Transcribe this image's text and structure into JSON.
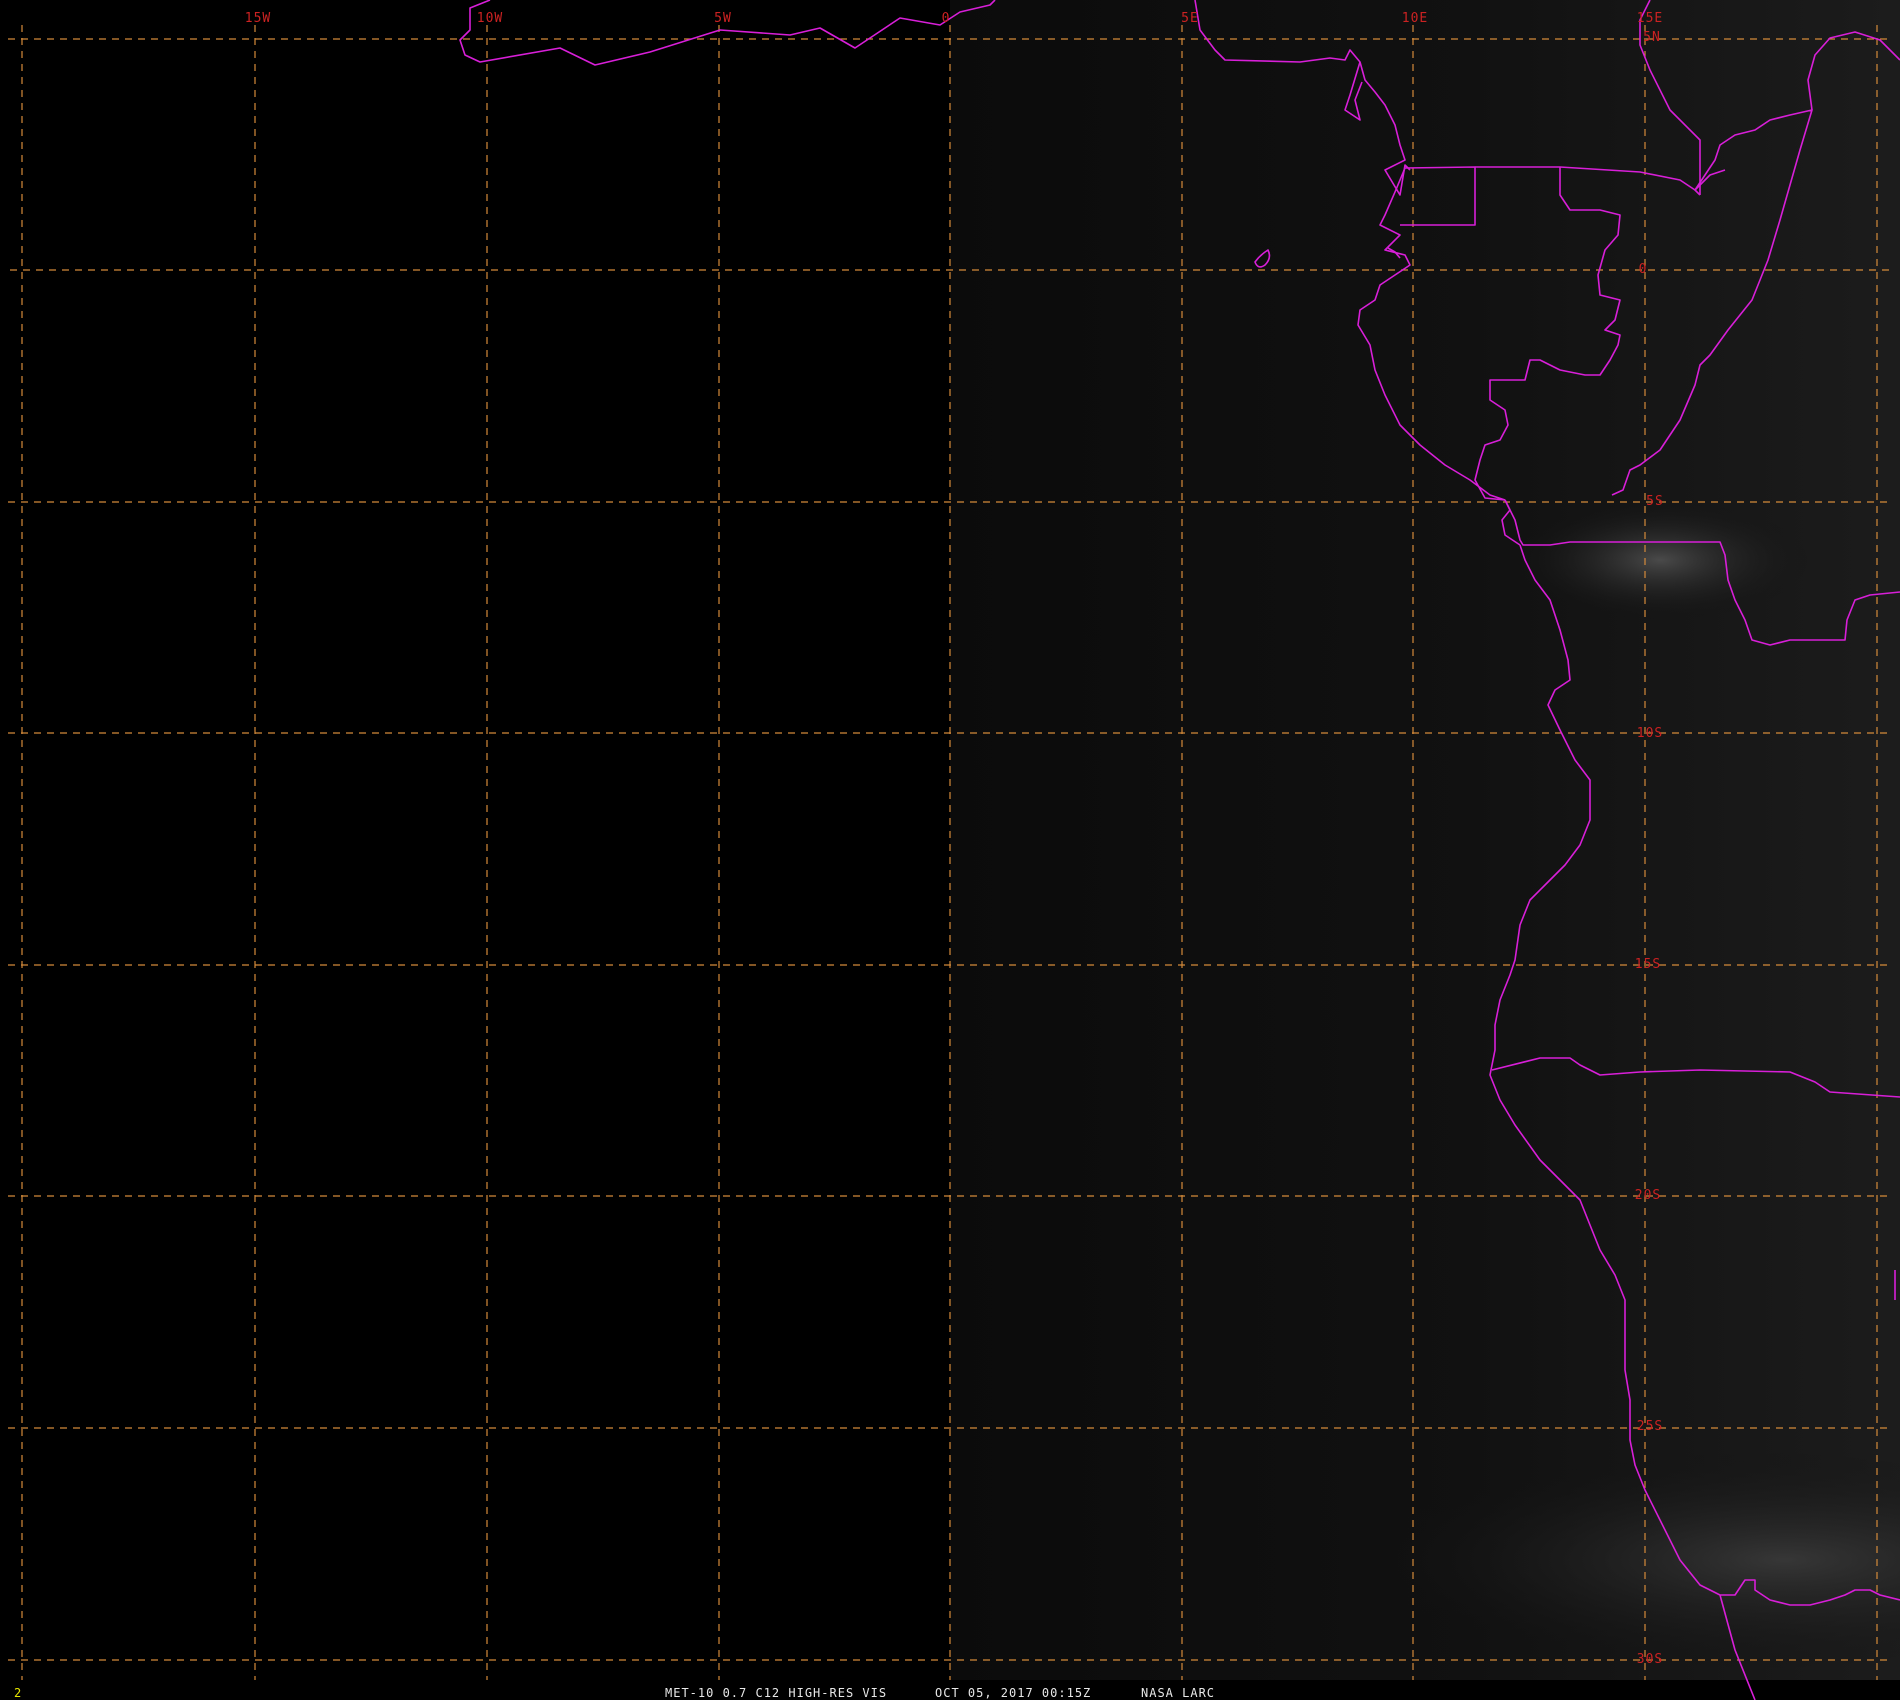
{
  "map": {
    "longitude_labels": [
      "15W",
      "10W",
      "5W",
      "0",
      "5E",
      "10E",
      "15E"
    ],
    "latitude_labels": [
      "5N",
      "0",
      "5S",
      "10S",
      "15S",
      "20S",
      "25S",
      "30S"
    ],
    "footer": {
      "frame_number": "2",
      "satellite_product": "MET-10 0.7 C12 HIGH-RES VIS",
      "timestamp": "OCT 05, 2017 00:15Z",
      "source": "NASA LARC"
    },
    "colors": {
      "background": "#000000",
      "grid": "#d48a3a",
      "boundaries": "#d81fd8",
      "grid_labels": "#cc2222",
      "footer_text": "#e8e8e8",
      "frame_number": "#e6e600"
    }
  }
}
